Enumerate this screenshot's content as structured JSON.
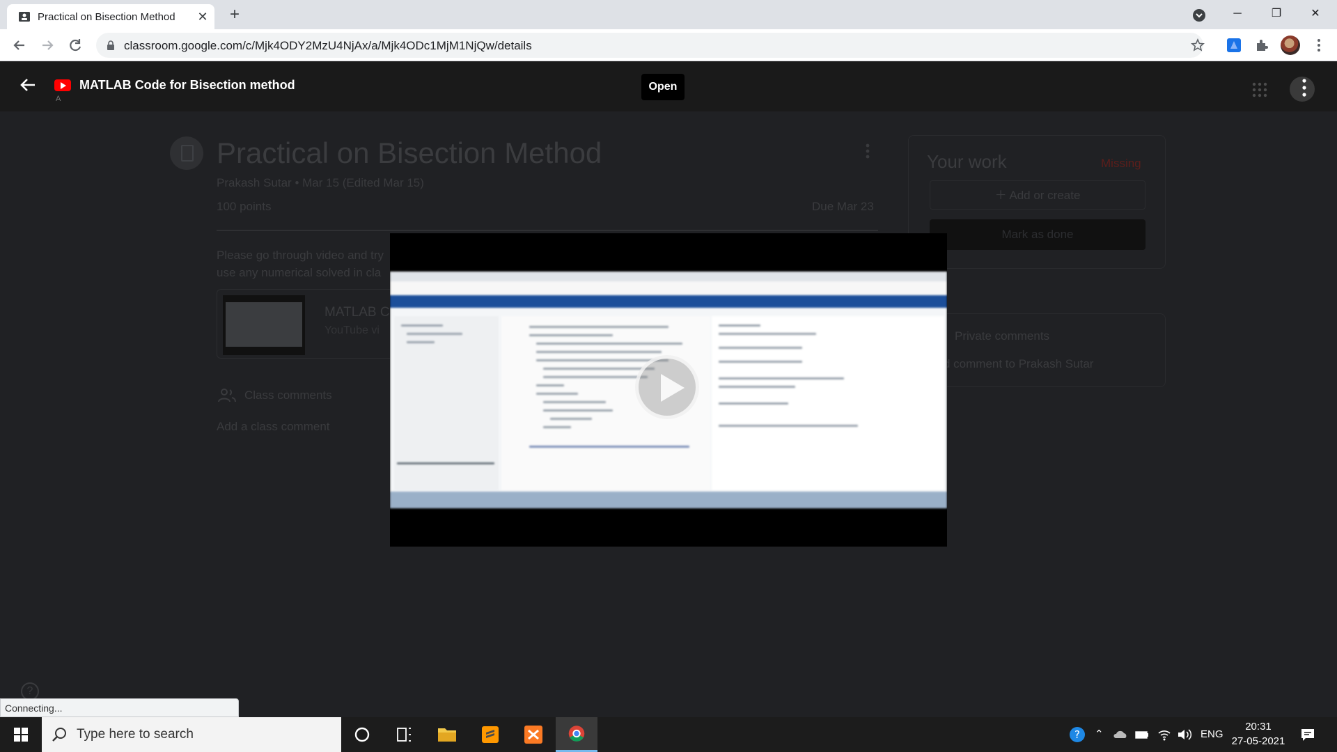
{
  "browser": {
    "tab_title": "Practical on Bisection Method",
    "url": "classroom.google.com/c/Mjk4ODY2MzU4NjAx/a/Mjk4ODc1MjM1NjQw/details",
    "status_text": "Connecting..."
  },
  "viewer": {
    "title": "MATLAB Code for Bisection method",
    "subtitle": "A",
    "open_label": "Open"
  },
  "assignment": {
    "title": "Practical on Bisection Method",
    "meta": "Prakash Sutar • Mar 15 (Edited Mar 15)",
    "points": "100 points",
    "due": "Due Mar 23",
    "description": "Please go through video and try\nuse any numerical solved in cla",
    "attachment_title": "MATLAB C",
    "attachment_sub": "YouTube vi",
    "class_comments_label": "Class comments",
    "add_class_comment": "Add a class comment"
  },
  "your_work": {
    "title": "Your work",
    "status": "Missing",
    "add_create": "Add or create",
    "mark_done": "Mark as done"
  },
  "private_comments": {
    "title": "Private comments",
    "add": "d comment to Prakash Sutar"
  },
  "taskbar": {
    "search_placeholder": "Type here to search",
    "lang": "ENG",
    "time": "20:31",
    "date": "27-05-2021"
  },
  "colors": {
    "youtube_red": "#ff0000",
    "missing_red": "#5c1e1b",
    "taskbar_bg": "#1c1c1c"
  }
}
